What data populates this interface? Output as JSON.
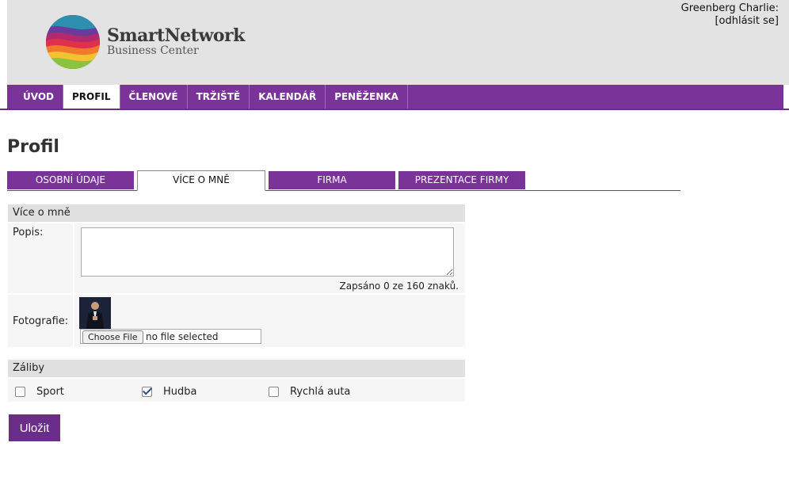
{
  "header": {
    "logo_title": "SmartNetwork",
    "logo_subtitle": "Business Center",
    "user_name": "Greenberg Charlie:",
    "logout_label": "[odhlásit se]"
  },
  "nav": {
    "items": [
      {
        "label": "ÚVOD"
      },
      {
        "label": "PROFIL"
      },
      {
        "label": "ČLENOVÉ"
      },
      {
        "label": "TRŽIŠTĚ"
      },
      {
        "label": "KALENDÁŘ"
      },
      {
        "label": "PENĚŽENKA"
      }
    ],
    "active": "PROFIL"
  },
  "page": {
    "title": "Profil"
  },
  "subtabs": {
    "items": [
      {
        "label": "OSOBNÍ ÚDAJE"
      },
      {
        "label": "VÍCE O MNĚ"
      },
      {
        "label": "FIRMA"
      },
      {
        "label": "PREZENTACE FIRMY"
      }
    ],
    "active": "VÍCE O MNĚ"
  },
  "about": {
    "heading": "Více o mně",
    "popis_label": "Popis:",
    "popis_value": "",
    "counter": "Zapsáno 0 ze 160 znaků.",
    "photo_label": "Fotografie:",
    "file_button": "Choose File",
    "file_status": "no file selected"
  },
  "hobbies": {
    "heading": "Záliby",
    "items": [
      {
        "label": "Sport",
        "checked": false
      },
      {
        "label": "Hudba",
        "checked": true
      },
      {
        "label": "Rychlá auta",
        "checked": false
      }
    ]
  },
  "actions": {
    "save_label": "Uložit"
  },
  "colors": {
    "brand_purple": "#7a3399",
    "header_bg": "#e3e3e3",
    "section_bg": "#e0e0e0"
  }
}
